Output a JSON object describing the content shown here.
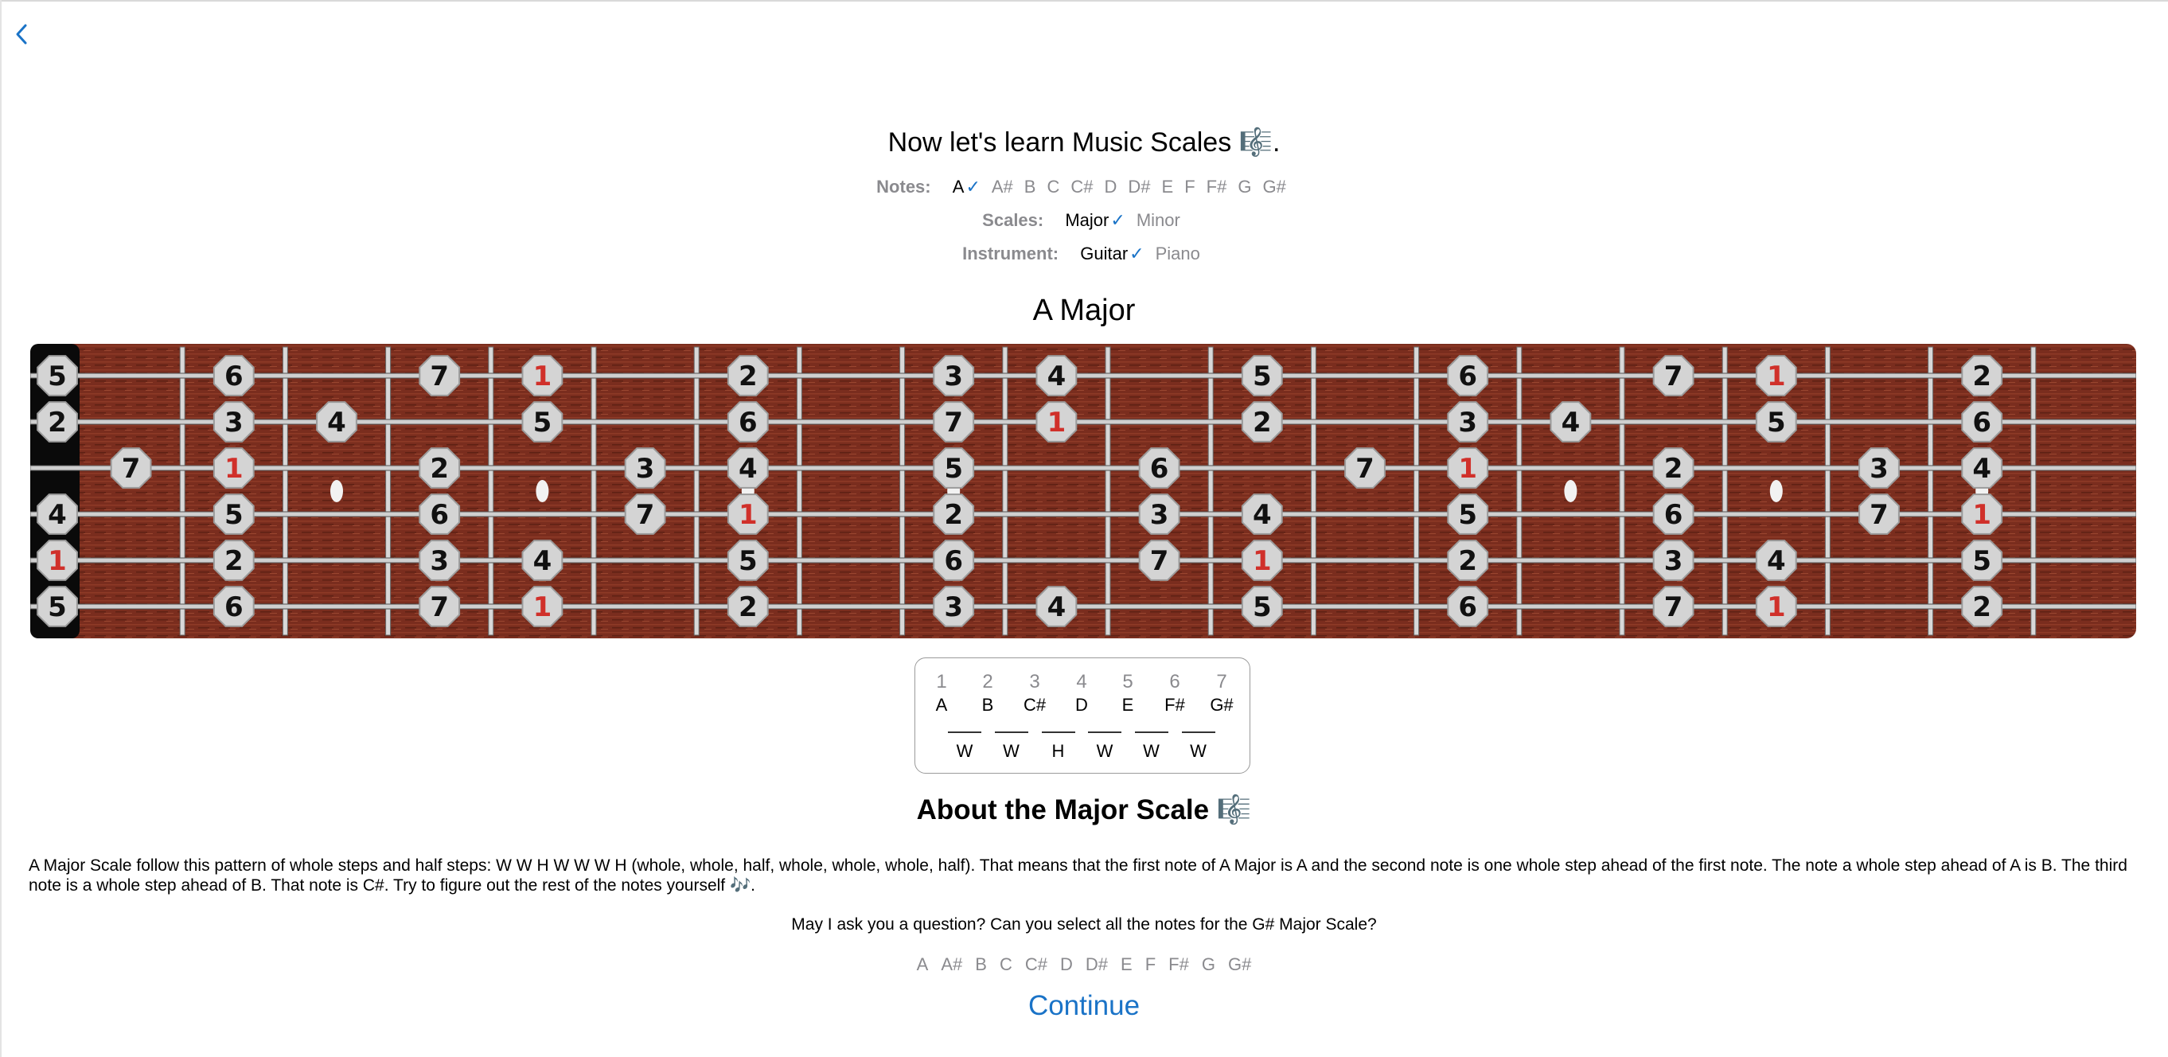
{
  "header": {
    "back_icon": "chevron-left-icon"
  },
  "title": "Now let's learn Music Scales 🎼.",
  "notes": {
    "label": "Notes:",
    "options": [
      "A",
      "A#",
      "B",
      "C",
      "C#",
      "D",
      "D#",
      "E",
      "F",
      "F#",
      "G",
      "G#"
    ],
    "selected": "A"
  },
  "scales": {
    "label": "Scales:",
    "options": [
      "Major",
      "Minor"
    ],
    "selected": "Major"
  },
  "instrument": {
    "label": "Instrument:",
    "options": [
      "Guitar",
      "Piano"
    ],
    "selected": "Guitar"
  },
  "scale_title": "A Major",
  "fretboard": {
    "frets": 20,
    "markers": [
      [
        "5",
        "6",
        "7",
        "1",
        "2",
        "3",
        "4",
        "5",
        "6",
        "7",
        "1",
        "2"
      ],
      [
        "2",
        "3",
        "4",
        "5",
        "6",
        "7",
        "1",
        "2",
        "3",
        "4",
        "5",
        "6"
      ],
      [
        "7",
        "1",
        "2",
        "3",
        "4",
        "5",
        "6",
        "7",
        "1",
        "2",
        "3",
        "4"
      ],
      [
        "4",
        "5",
        "6",
        "7",
        "1",
        "2",
        "3",
        "4",
        "5",
        "6",
        "7",
        "1"
      ],
      [
        "1",
        "2",
        "3",
        "4",
        "5",
        "6",
        "7",
        "1",
        "2",
        "3",
        "4",
        "5"
      ],
      [
        "5",
        "6",
        "7",
        "1",
        "2",
        "3",
        "4",
        "5",
        "6",
        "7",
        "1",
        "2"
      ]
    ]
  },
  "intervals": {
    "degrees": [
      "1",
      "2",
      "3",
      "4",
      "5",
      "6",
      "7"
    ],
    "notes": [
      "A",
      "B",
      "C#",
      "D",
      "E",
      "F#",
      "G#"
    ],
    "steps": [
      "W",
      "W",
      "H",
      "W",
      "W",
      "W"
    ]
  },
  "about_title": "About the Major Scale 🎼",
  "description": "A Major Scale follow this pattern of whole steps and half steps: W W H W W W H (whole, whole, half, whole, whole, whole, half). That means that the first note of A Major is A and the second note is one whole step ahead of the first note. The note a whole step ahead of A is B. The third note is a whole step ahead of B. That note is C#. Try to figure out the rest of the notes yourself 🎶.",
  "question": "May I ask you a question? Can you select all the notes for the G# Major Scale?",
  "answer_options": [
    "A",
    "A#",
    "B",
    "C",
    "C#",
    "D",
    "D#",
    "E",
    "F",
    "F#",
    "G",
    "G#"
  ],
  "continue_label": "Continue",
  "colors": {
    "accent": "#1a73c7",
    "root_note": "#d0302a",
    "fretboard_wood": "#7a2d1e"
  }
}
